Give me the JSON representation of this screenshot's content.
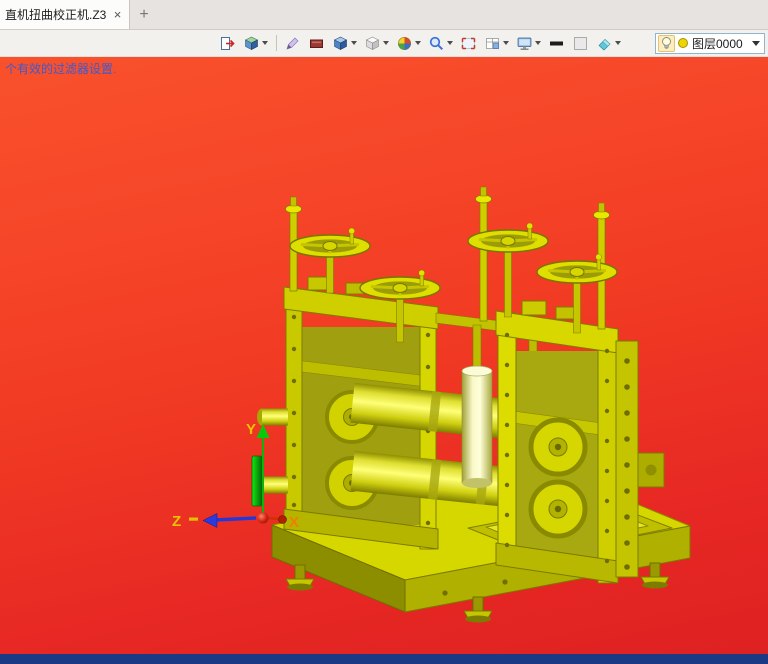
{
  "tabbar": {
    "tab_title": "直机扭曲校正机.Z3",
    "close_glyph": "×",
    "new_tab_glyph": "+"
  },
  "toolbar": {
    "items": [
      {
        "name": "door-arrow-icon",
        "dropdown": false
      },
      {
        "name": "multi-cube-icon",
        "dropdown": true
      },
      {
        "name": "pencil-icon",
        "dropdown": false
      },
      {
        "name": "red-panel-icon",
        "dropdown": false
      },
      {
        "name": "blue-cube-icon",
        "dropdown": true
      },
      {
        "name": "white-cube-icon",
        "dropdown": true
      },
      {
        "name": "color-wheel-icon",
        "dropdown": true
      },
      {
        "name": "magnifier-icon",
        "dropdown": true
      },
      {
        "name": "select-window-icon",
        "dropdown": false
      },
      {
        "name": "grid-window-icon",
        "dropdown": true
      },
      {
        "name": "monitor-icon",
        "dropdown": true
      },
      {
        "name": "black-dash-icon",
        "dropdown": false
      },
      {
        "name": "gray-square-icon",
        "dropdown": false
      },
      {
        "name": "cyan-eraser-icon",
        "dropdown": true
      }
    ]
  },
  "layer_combo": {
    "icon": "lightbulb-icon",
    "color_dot": "#eed400",
    "label": "图层0000"
  },
  "viewport": {
    "hint_text": "个有效的过滤器设置.",
    "model": "yellow-straightening-machine-3d-model",
    "axis_labels": {
      "x": "X",
      "y": "Y",
      "z": "Z"
    }
  },
  "colors": {
    "viewport_gradient_top": "#f9512c",
    "viewport_gradient_bottom": "#de2121",
    "model_yellow": "#e2e200",
    "hint_text": "#3b5bd0",
    "statusbar": "#1a3a85",
    "axis_x": "#cc3300",
    "axis_y": "#0cb40c",
    "axis_z": "#2438d8",
    "axis_label_yellow": "#e9c400",
    "axis_label_orange": "#f07d00"
  }
}
